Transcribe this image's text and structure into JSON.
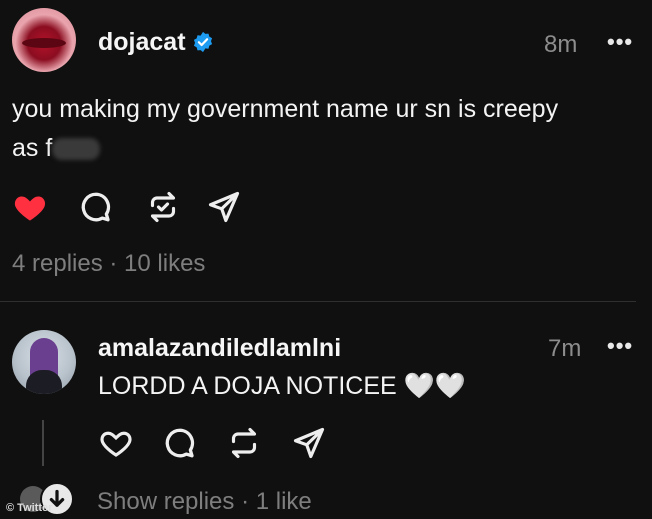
{
  "post": {
    "username": "dojacat",
    "time": "8m",
    "more": "•••",
    "text_line1": "you making my government name ur sn is creepy",
    "text_line2": "as f",
    "meta": "4 replies · 10 likes"
  },
  "reply": {
    "username": "amalazandiledlamlni",
    "time": "7m",
    "more": "•••",
    "text": "LORDD A DOJA NOTICEE 🤍🤍",
    "meta": "Show replies · 1 like"
  },
  "watermark": "© Twitter",
  "colors": {
    "background": "#101010",
    "like_active": "#ff3040",
    "verified": "#1d9bf0",
    "muted": "#7e7e7e"
  }
}
